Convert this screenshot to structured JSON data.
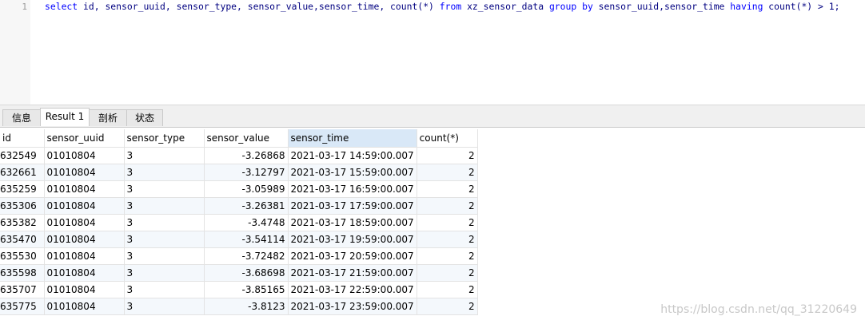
{
  "editor": {
    "line_number": "1",
    "sql": {
      "t1": "select",
      "t2": " id, sensor_uuid, sensor_type, sensor_value,sensor_time, count(*) ",
      "t3": "from",
      "t4": " xz_sensor_data ",
      "t5": "group by",
      "t6": " sensor_uuid,sensor_time ",
      "t7": "having",
      "t8": " count(*) > 1;"
    }
  },
  "tabs": [
    "信息",
    "Result 1",
    "剖析",
    "状态"
  ],
  "active_tab": "Result 1",
  "table": {
    "columns": [
      "id",
      "sensor_uuid",
      "sensor_type",
      "sensor_value",
      "sensor_time",
      "count(*)"
    ],
    "rows": [
      [
        "632549",
        "01010804",
        "3",
        "-3.26868",
        "2021-03-17 14:59:00.007",
        "2"
      ],
      [
        "632661",
        "01010804",
        "3",
        "-3.12797",
        "2021-03-17 15:59:00.007",
        "2"
      ],
      [
        "635259",
        "01010804",
        "3",
        "-3.05989",
        "2021-03-17 16:59:00.007",
        "2"
      ],
      [
        "635306",
        "01010804",
        "3",
        "-3.26381",
        "2021-03-17 17:59:00.007",
        "2"
      ],
      [
        "635382",
        "01010804",
        "3",
        "-3.4748",
        "2021-03-17 18:59:00.007",
        "2"
      ],
      [
        "635470",
        "01010804",
        "3",
        "-3.54114",
        "2021-03-17 19:59:00.007",
        "2"
      ],
      [
        "635530",
        "01010804",
        "3",
        "-3.72482",
        "2021-03-17 20:59:00.007",
        "2"
      ],
      [
        "635598",
        "01010804",
        "3",
        "-3.68698",
        "2021-03-17 21:59:00.007",
        "2"
      ],
      [
        "635707",
        "01010804",
        "3",
        "-3.85165",
        "2021-03-17 22:59:00.007",
        "2"
      ],
      [
        "635775",
        "01010804",
        "3",
        "-3.8123",
        "2021-03-17 23:59:00.007",
        "2"
      ]
    ]
  },
  "watermark": "https://blog.csdn.net/qq_31220649"
}
